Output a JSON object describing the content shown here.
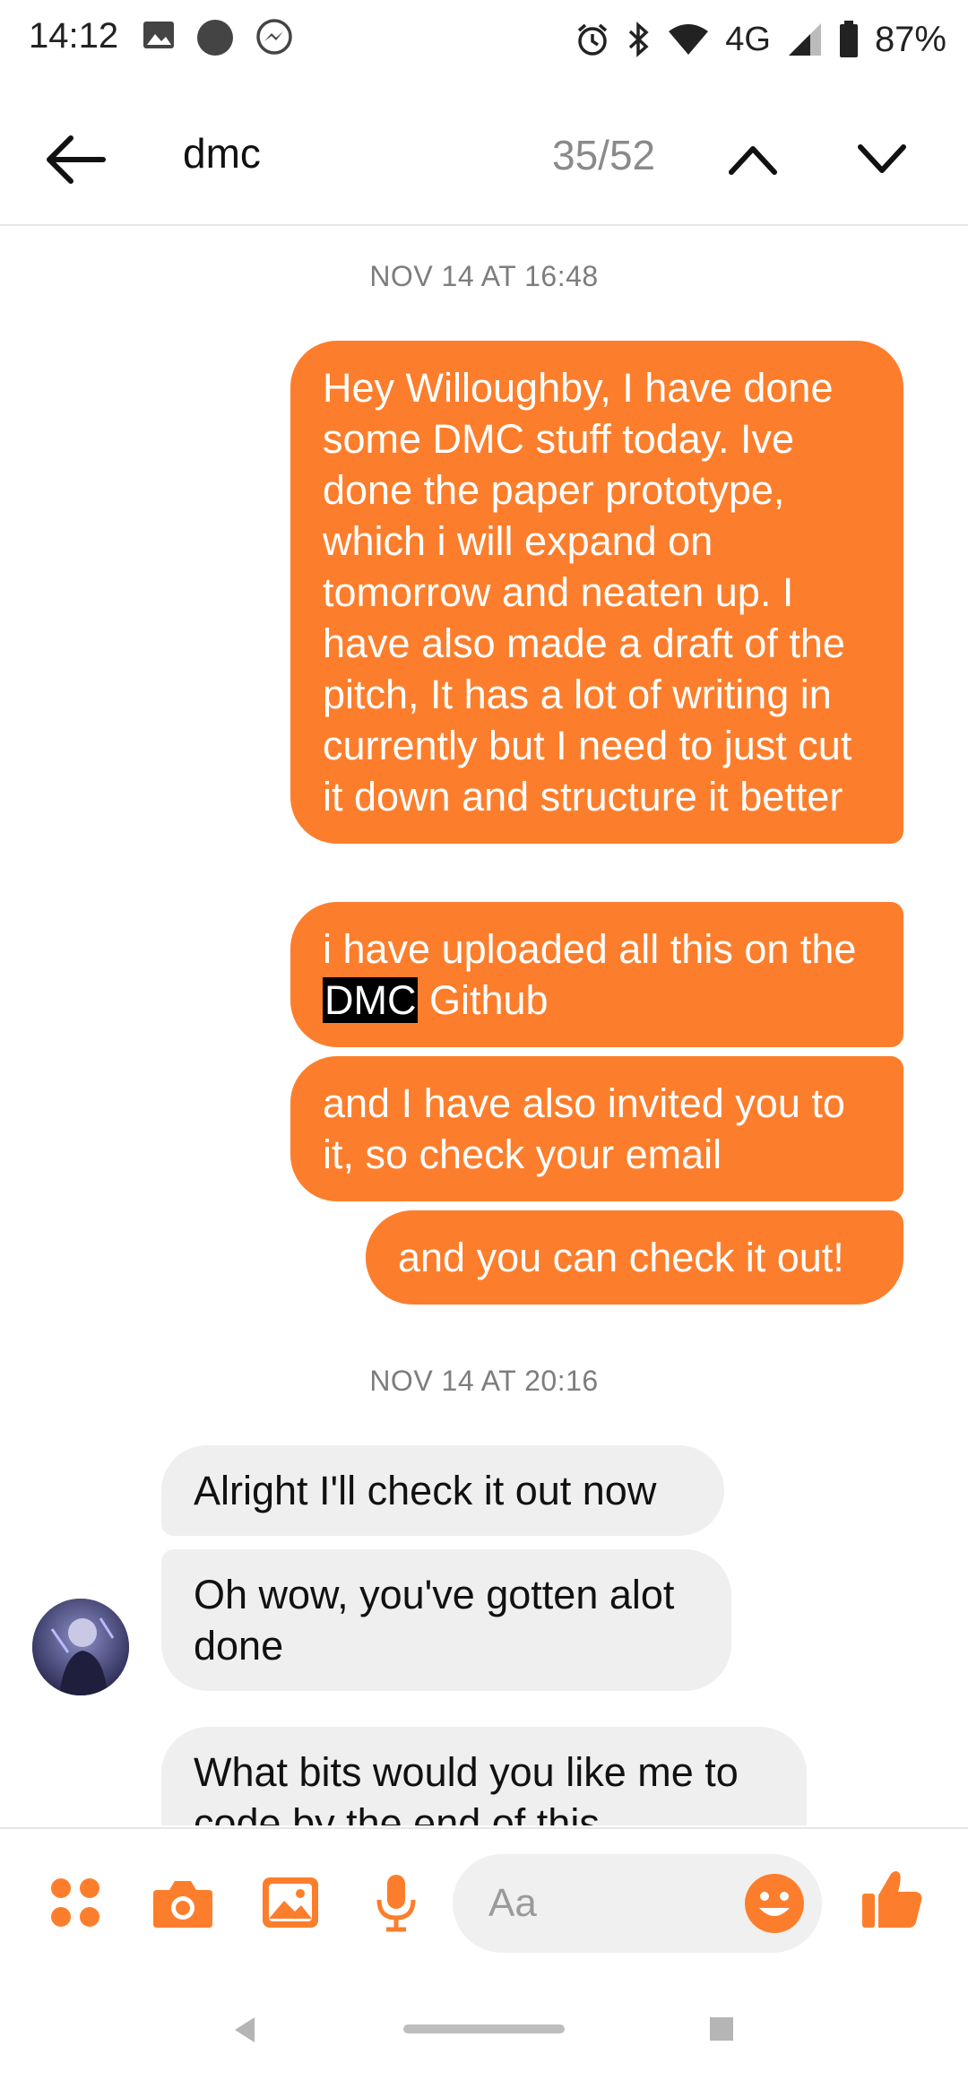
{
  "status_bar": {
    "time": "14:12",
    "network": "4G",
    "battery": "87%"
  },
  "search": {
    "query": "dmc",
    "counter": "35/52"
  },
  "messages": {
    "timestamp_1": "NOV 14 AT 16:48",
    "out_1": "Hey Willoughby, I have done some DMC stuff today. Ive done the paper prototype, which i will expand on tomorrow and neaten up. I have also made a draft of the pitch, It has a lot of writing in currently but I need to just cut it down and structure it better",
    "out_2_before": "i have uploaded all this on the ",
    "out_2_highlight": "DMC",
    "out_2_after": " Github",
    "out_3": "and I have also invited you to it, so check your email",
    "out_4": "and you can check it out!",
    "timestamp_2": "NOV 14 AT 20:16",
    "in_1": "Alright I'll check it out now",
    "in_2": "Oh wow, you've gotten alot done",
    "in_3": "What bits would you like me to code by the end of this"
  },
  "composer": {
    "placeholder": "Aa"
  },
  "colors": {
    "accent": "#fc7e2c",
    "incoming_bubble": "#efefef",
    "highlight": "#000000"
  },
  "icons": [
    "back-arrow-icon",
    "chevron-up-icon",
    "chevron-down-icon",
    "more-dots-icon",
    "camera-icon",
    "gallery-icon",
    "microphone-icon",
    "emoji-icon",
    "thumbs-up-icon",
    "nav-back-icon",
    "nav-home-pill",
    "nav-recents-icon"
  ]
}
